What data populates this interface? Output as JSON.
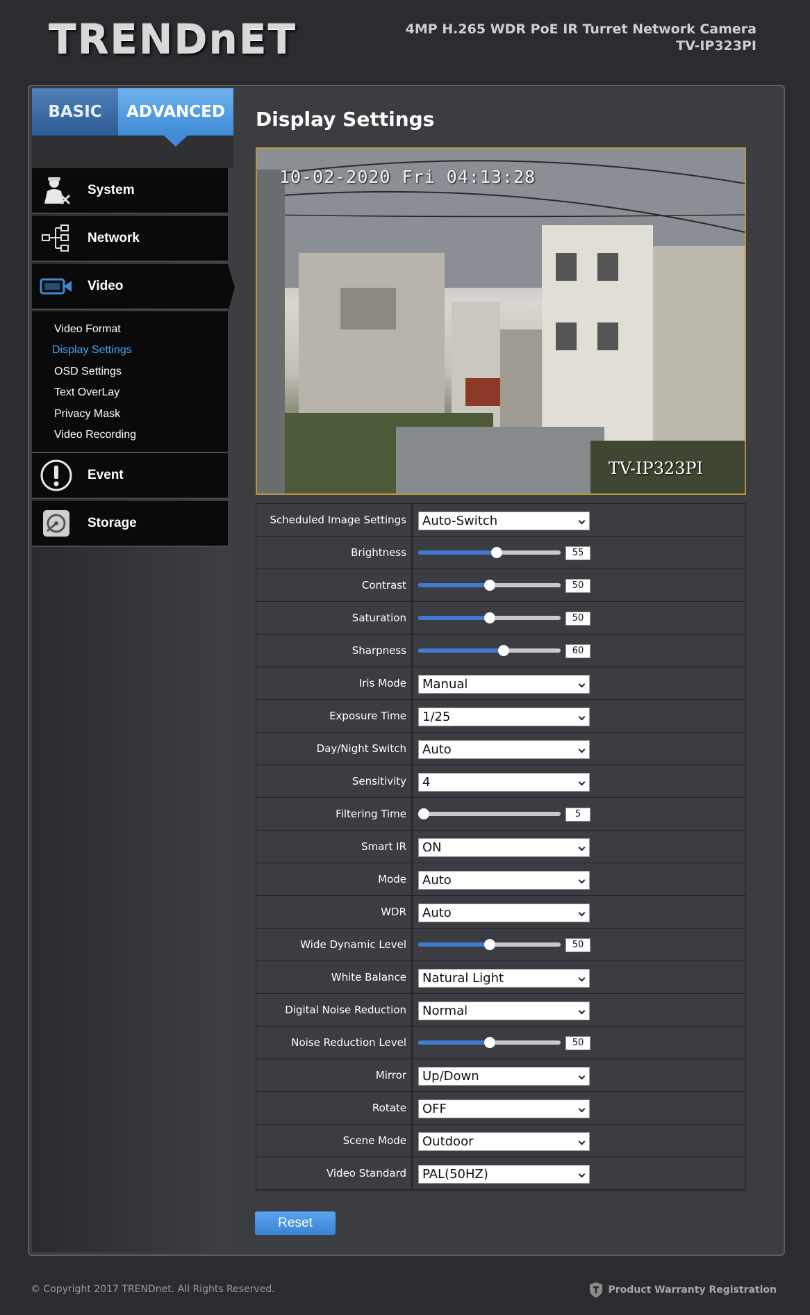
{
  "header": {
    "logo": "TRENDnET",
    "product_name": "4MP H.265 WDR PoE IR Turret Network Camera",
    "model": "TV-IP323PI"
  },
  "tabs": {
    "basic": "BASIC",
    "advanced": "ADVANCED"
  },
  "sidebar": {
    "system": "System",
    "network": "Network",
    "video": "Video",
    "video_items": [
      "Video Format",
      "Display Settings",
      "OSD Settings",
      "Text OverLay",
      "Privacy Mask",
      "Video Recording"
    ],
    "event": "Event",
    "storage": "Storage"
  },
  "page_title": "Display Settings",
  "live_view": {
    "timestamp": "10-02-2020 Fri 04:13:28",
    "camera_name": "TV-IP323PI"
  },
  "settings": {
    "scheduled_image": {
      "label": "Scheduled Image Settings",
      "value": "Auto-Switch"
    },
    "brightness": {
      "label": "Brightness",
      "value": "55",
      "fraction": 0.55
    },
    "contrast": {
      "label": "Contrast",
      "value": "50",
      "fraction": 0.5
    },
    "saturation": {
      "label": "Saturation",
      "value": "50",
      "fraction": 0.5
    },
    "sharpness": {
      "label": "Sharpness",
      "value": "60",
      "fraction": 0.6
    },
    "iris_mode": {
      "label": "Iris Mode",
      "value": "Manual"
    },
    "exposure_time": {
      "label": "Exposure Time",
      "value": "1/25"
    },
    "day_night_switch": {
      "label": "Day/Night Switch",
      "value": "Auto"
    },
    "sensitivity": {
      "label": "Sensitivity",
      "value": "4"
    },
    "filtering_time": {
      "label": "Filtering Time",
      "value": "5",
      "fraction": 0.0
    },
    "smart_ir": {
      "label": "Smart IR",
      "value": "ON"
    },
    "mode": {
      "label": "Mode",
      "value": "Auto"
    },
    "wdr": {
      "label": "WDR",
      "value": "Auto"
    },
    "wide_dynamic_level": {
      "label": "Wide Dynamic Level",
      "value": "50",
      "fraction": 0.5
    },
    "white_balance": {
      "label": "White Balance",
      "value": "Natural Light"
    },
    "digital_noise_reduction": {
      "label": "Digital Noise Reduction",
      "value": "Normal"
    },
    "noise_reduction_level": {
      "label": "Noise Reduction Level",
      "value": "50",
      "fraction": 0.5
    },
    "mirror": {
      "label": "Mirror",
      "value": "Up/Down"
    },
    "rotate": {
      "label": "Rotate",
      "value": "OFF"
    },
    "scene_mode": {
      "label": "Scene Mode",
      "value": "Outdoor"
    },
    "video_standard": {
      "label": "Video Standard",
      "value": "PAL(50HZ)"
    }
  },
  "reset_label": "Reset",
  "footer": {
    "copyright": "© Copyright 2017 TRENDnet. All Rights Reserved.",
    "warranty": "Product Warranty Registration"
  },
  "colors": {
    "accent": "#3f8bd6",
    "active_link": "#4aa3f0",
    "slider_fill": "#3f79d0"
  }
}
